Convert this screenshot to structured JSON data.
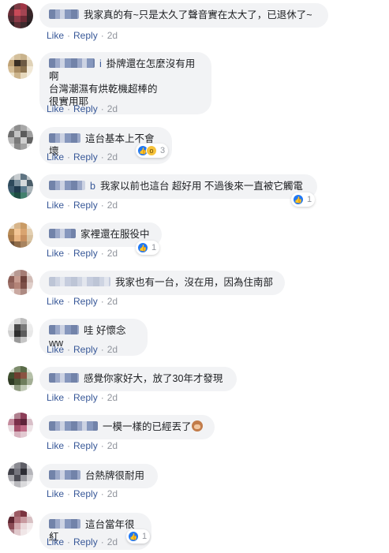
{
  "comments": [
    {
      "text": "我家真的有~只是太久了聲音實在太大了，已退休了~",
      "name_visible": "",
      "like": "Like",
      "reply": "Reply",
      "time": "2d",
      "reactions": null
    },
    {
      "text": "掛牌還在怎麼沒有用啊\n台灣潮濕有烘乾機超棒的\n很實用耶",
      "name_visible": "i",
      "like": "Like",
      "reply": "Reply",
      "time": "2d",
      "reactions": null
    },
    {
      "text": "這台基本上不會壞",
      "name_visible": "",
      "like": "Like",
      "reply": "Reply",
      "time": "2d",
      "reactions": {
        "count": "3",
        "types": [
          "like-icon",
          "wow-icon"
        ]
      }
    },
    {
      "text": "我家以前也這台 超好用 不過後來一直被它觸電",
      "name_visible": "b",
      "like": "Like",
      "reply": "Reply",
      "time": "2d",
      "reactions": {
        "count": "1",
        "types": [
          "like-icon"
        ]
      }
    },
    {
      "text": "家裡還在服役中",
      "name_visible": "",
      "like": "Like",
      "reply": "Reply",
      "time": "2d",
      "reactions": {
        "count": "1",
        "types": [
          "like-icon"
        ]
      }
    },
    {
      "text": "我家也有一台，沒在用，因為住南部",
      "name_visible": "",
      "like": "Like",
      "reply": "Reply",
      "time": "2d",
      "reactions": null
    },
    {
      "text": "哇 好懷念ww",
      "name_visible": "",
      "like": "Like",
      "reply": "Reply",
      "time": "2d",
      "reactions": null
    },
    {
      "text": "感覺你家好大，放了30年才發現",
      "name_visible": "",
      "like": "Like",
      "reply": "Reply",
      "time": "2d",
      "reactions": null
    },
    {
      "text": "一模一樣的已經丟了",
      "name_visible": "",
      "like": "Like",
      "reply": "Reply",
      "time": "2d",
      "reactions": null
    },
    {
      "text": "台熱牌很耐用",
      "name_visible": "",
      "like": "Like",
      "reply": "Reply",
      "time": "2d",
      "reactions": null
    },
    {
      "text": "這台當年很紅",
      "name_visible": "",
      "like": "Like",
      "reply": "Reply",
      "time": "2d",
      "reactions": {
        "count": "1",
        "types": [
          "like-icon"
        ]
      }
    }
  ],
  "separator": "·",
  "colors": {
    "link": "#385898",
    "bubble": "#f2f3f5",
    "meta": "#90949c",
    "like_blue": "#2078f4"
  }
}
